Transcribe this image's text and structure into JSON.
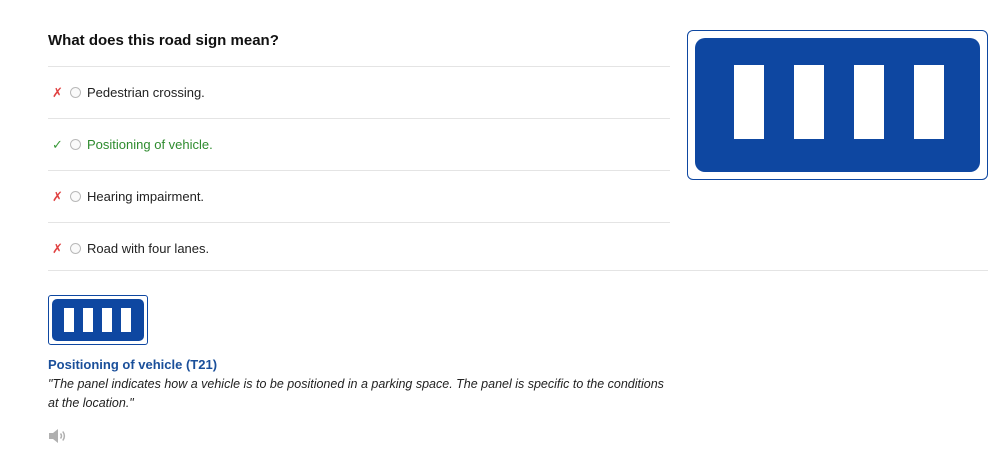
{
  "question": "What does this road sign mean?",
  "options": [
    {
      "mark": "✗",
      "label": "Pedestrian crossing."
    },
    {
      "mark": "✓",
      "label": "Positioning of vehicle."
    },
    {
      "mark": "✗",
      "label": "Hearing impairment."
    },
    {
      "mark": "✗",
      "label": "Road with four lanes."
    }
  ],
  "explanation": {
    "title": "Positioning of vehicle (T21)",
    "text": "\"The panel indicates how a vehicle is to be positioned in a parking space. The panel is specific to the conditions at the location.\""
  },
  "colors": {
    "sign_blue": "#0e47a1",
    "correct_green": "#2e8b2e",
    "wrong_red": "#e04040",
    "title_blue": "#1a4f9a"
  },
  "icons": {
    "sign": "road-sign-t21-icon",
    "audio": "speaker-icon"
  }
}
